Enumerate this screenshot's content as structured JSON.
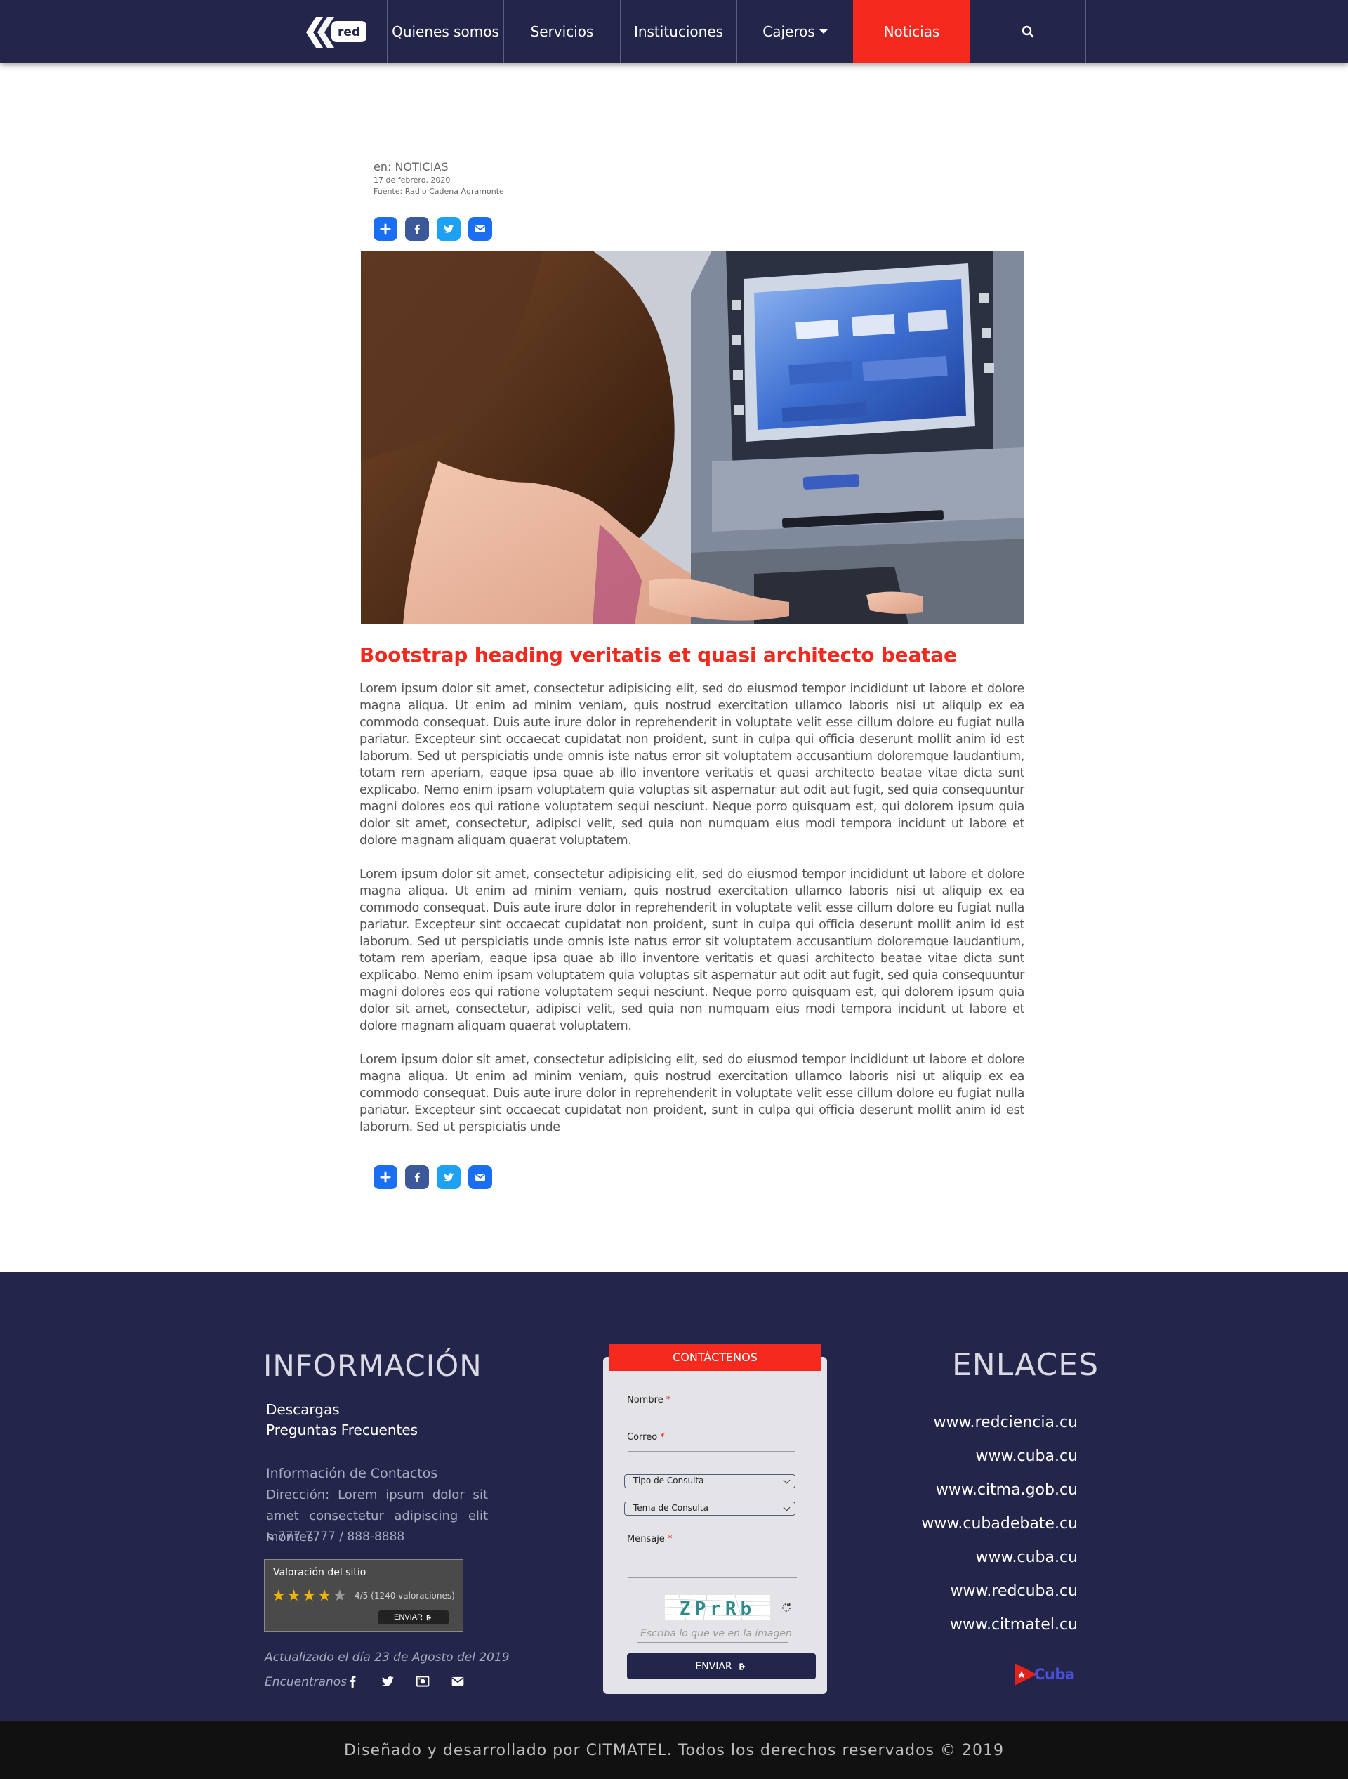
{
  "nav": {
    "logo_text": "red",
    "items": [
      {
        "label": "Quienes somos"
      },
      {
        "label": "Servicios"
      },
      {
        "label": "Instituciones"
      },
      {
        "label": "Cajeros"
      },
      {
        "label": "Noticias"
      }
    ]
  },
  "article": {
    "category": "en: NOTICIAS",
    "date": "17 de febrero, 2020",
    "source": "Fuente: Radio Cadena Agramonte",
    "title": "Bootstrap heading veritatis et quasi architecto beatae",
    "paragraphs": [
      "Lorem ipsum dolor sit amet, consectetur adipisicing elit, sed do eiusmod tempor incididunt ut labore et dolore magna aliqua. Ut enim ad minim veniam, quis nostrud exercitation ullamco laboris nisi ut aliquip ex ea commodo consequat. Duis aute irure dolor in reprehenderit in voluptate velit esse cillum dolore eu fugiat nulla pariatur. Excepteur sint occaecat cupidatat non proident, sunt in culpa qui officia deserunt mollit anim id est laborum. Sed ut perspiciatis unde omnis iste natus error sit voluptatem accusantium doloremque laudantium, totam rem aperiam, eaque ipsa quae ab illo inventore veritatis et quasi architecto beatae vitae dicta sunt explicabo. Nemo enim ipsam voluptatem quia voluptas sit aspernatur aut odit aut fugit, sed quia consequuntur magni dolores eos qui ratione voluptatem sequi nesciunt. Neque porro quisquam est, qui dolorem ipsum quia dolor sit amet, consectetur, adipisci velit, sed quia non numquam eius modi tempora incidunt ut labore et dolore magnam aliquam quaerat voluptatem.",
      "Lorem ipsum dolor sit amet, consectetur adipisicing elit, sed do eiusmod tempor incididunt ut labore et dolore magna aliqua. Ut enim ad minim veniam, quis nostrud exercitation ullamco laboris nisi ut aliquip ex ea commodo consequat. Duis aute irure dolor in reprehenderit in voluptate velit esse cillum dolore eu fugiat nulla pariatur. Excepteur sint occaecat cupidatat non proident, sunt in culpa qui officia deserunt mollit anim id est laborum. Sed ut perspiciatis unde omnis iste natus error sit voluptatem accusantium doloremque laudantium, totam rem aperiam, eaque ipsa quae ab illo inventore veritatis et quasi architecto beatae vitae dicta sunt explicabo. Nemo enim ipsam voluptatem quia voluptas sit aspernatur aut odit aut fugit, sed quia consequuntur magni dolores eos qui ratione voluptatem sequi nesciunt. Neque porro quisquam est, qui dolorem ipsum quia dolor sit amet, consectetur, adipisci velit, sed quia non numquam eius modi tempora incidunt ut labore et dolore magnam aliquam quaerat voluptatem.",
      "Lorem ipsum dolor sit amet, consectetur adipisicing elit, sed do eiusmod tempor incididunt ut labore et dolore magna aliqua. Ut enim ad minim veniam, quis nostrud exercitation ullamco laboris nisi ut aliquip ex ea commodo consequat. Duis aute irure dolor in reprehenderit in voluptate velit esse cillum dolore eu fugiat nulla pariatur. Excepteur sint occaecat cupidatat non proident, sunt in culpa qui officia deserunt mollit anim id est laborum. Sed ut perspiciatis unde"
    ]
  },
  "footer": {
    "info": {
      "title": "INFORMACIÓN",
      "links": [
        "Descargas",
        "Preguntas Frecuentes"
      ],
      "contact_heading": "Información de Contactos",
      "address": "Dirección: Lorem ipsum dolor sit amet consectetur adipiscing elit montes.",
      "phone": "777-7777 / 888-8888",
      "rating": {
        "title": "Valoración del sitio",
        "value_text": "4/5",
        "count_text": "(1240 valoraciones)",
        "stars": 4,
        "max": 5,
        "button": "ENVIAR"
      },
      "updated": "Actualizado el día 23 de Agosto del 2019",
      "find_us": "Encuentranos"
    },
    "contact": {
      "tab": "CONTÁCTENOS",
      "name_label": "Nombre",
      "email_label": "Correo",
      "type_select": "Tipo de Consulta",
      "topic_select": "Tema de Consulta",
      "message_label": "Mensaje",
      "required_mark": "*",
      "captcha_text": "ZPrRb",
      "captcha_hint": "Escriba lo que ve en la imagen",
      "send": "ENVIAR"
    },
    "links": {
      "title": "ENLACES",
      "items": [
        "www.redciencia.cu",
        "www.cuba.cu",
        "www.citma.gob.cu",
        "www.cubadebate.cu",
        "www.cuba.cu",
        "www.redcuba.cu",
        "www.citmatel.cu"
      ],
      "cuba_logo": "Cuba"
    },
    "copyright": "Diseñado y desarrollado por CITMATEL. Todos los derechos reservados © 2019"
  },
  "colors": {
    "navy": "#23264a",
    "red": "#f5291e",
    "blue_share": "#1a6ef2"
  }
}
